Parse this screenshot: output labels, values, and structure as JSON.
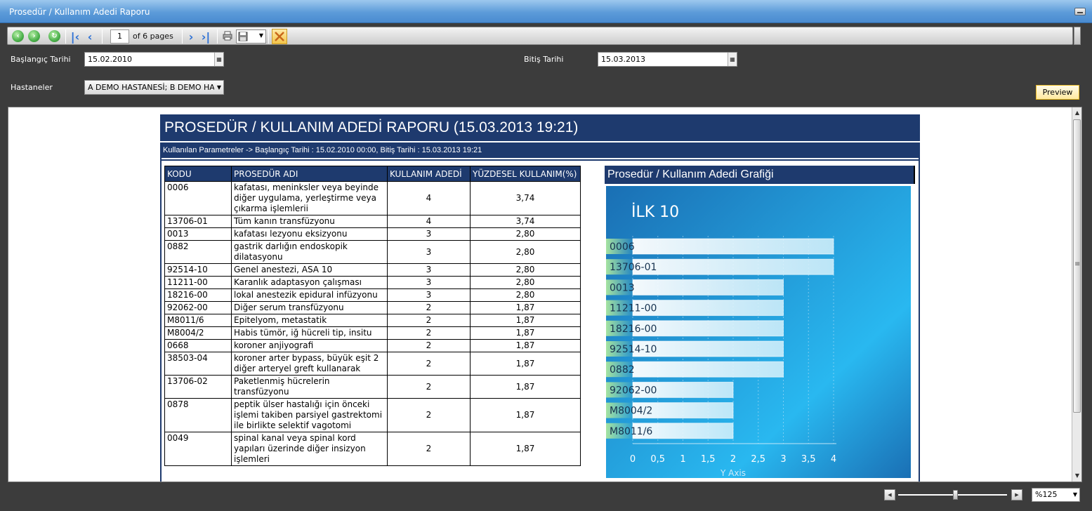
{
  "window": {
    "title": "Prosedür / Kullanım Adedi Raporu"
  },
  "toolbar": {
    "page_value": "1",
    "page_of_label": "of 6 pages"
  },
  "params": {
    "start_label": "Başlangıç Tarihi",
    "start_value": "15.02.2010",
    "end_label": "Bitiş Tarihi",
    "end_value": "15.03.2013",
    "hospitals_label": "Hastaneler",
    "hospitals_value": "A DEMO HASTANESİ; B DEMO HASTANESİ",
    "preview_label": "Preview"
  },
  "report": {
    "title": "PROSEDÜR / KULLANIM ADEDİ RAPORU (15.03.2013 19:21)",
    "params_line": "Kullanılan Parametreler -> Başlangıç Tarihi : 15.02.2010 00:00, Bitiş Tarihi : 15.03.2013 19:21",
    "columns": [
      "KODU",
      "PROSEDÜR ADI",
      "KULLANIM ADEDİ",
      "YÜZDESEL KULLANIM(%)"
    ],
    "rows": [
      {
        "code": "0006",
        "name": "kafatası, meninksler veya beyinde diğer uygulama, yerleştirme veya çıkarma işlemlerii",
        "count": "4",
        "pct": "3,74"
      },
      {
        "code": "13706-01",
        "name": "Tüm kanın transfüzyonu",
        "count": "4",
        "pct": "3,74"
      },
      {
        "code": "0013",
        "name": " kafatası lezyonu eksizyonu",
        "count": "3",
        "pct": "2,80"
      },
      {
        "code": "0882",
        "name": "gastrik darlığın endoskopik dilatasyonu",
        "count": "3",
        "pct": "2,80"
      },
      {
        "code": "92514-10",
        "name": "Genel anestezi, ASA 10",
        "count": "3",
        "pct": "2,80"
      },
      {
        "code": "11211-00",
        "name": "Karanlık adaptasyon çalışması",
        "count": "3",
        "pct": "2,80"
      },
      {
        "code": "18216-00",
        "name": "lokal anestezik epidural infüzyonu",
        "count": "3",
        "pct": "2,80"
      },
      {
        "code": "92062-00",
        "name": "Diğer serum transfüzyonu",
        "count": "2",
        "pct": "1,87"
      },
      {
        "code": "M8011/6",
        "name": "Epitelyom, metastatik",
        "count": "2",
        "pct": "1,87"
      },
      {
        "code": "M8004/2",
        "name": "Habis tümör, iğ hücreli tip, insitu",
        "count": "2",
        "pct": "1,87"
      },
      {
        "code": "0668",
        "name": "koroner anjiyografi",
        "count": "2",
        "pct": "1,87"
      },
      {
        "code": "38503-04",
        "name": "koroner arter bypass, büyük eşit 2 diğer arteryel greft kullanarak",
        "count": "2",
        "pct": "1,87"
      },
      {
        "code": "13706-02",
        "name": "Paketlenmiş hücrelerin transfüzyonu",
        "count": "2",
        "pct": "1,87"
      },
      {
        "code": "0878",
        "name": "peptik ülser hastalığı için önceki işlemi takiben parsiyel gastrektomi ile birlikte selektif vagotomi",
        "count": "2",
        "pct": "1,87"
      },
      {
        "code": "0049",
        "name": "spinal kanal veya spinal kord yapıları üzerinde diğer insizyon işlemleri",
        "count": "2",
        "pct": "1,87"
      }
    ],
    "chart_header": "Prosedür / Kullanım Adedi Grafiği"
  },
  "chart_data": {
    "type": "bar",
    "orientation": "horizontal",
    "title": "İLK 10",
    "categories": [
      "0006",
      "13706-01",
      "0013",
      "11211-00",
      "18216-00",
      "92514-10",
      "0882",
      "92062-00",
      "M8004/2",
      "M8011/6"
    ],
    "values": [
      4,
      4,
      3,
      3,
      3,
      3,
      3,
      2,
      2,
      2
    ],
    "xlim": [
      0,
      4
    ],
    "xticks": [
      "0",
      "0,5",
      "1",
      "1,5",
      "2",
      "2,5",
      "3",
      "3,5",
      "4"
    ],
    "xlabel": "Y Axis",
    "grid": true,
    "colors": {
      "bg_dark": "#1a6fb4",
      "bg_light": "#29b8f0",
      "bar": "#d6f1fb",
      "label_bg": "#a6e3a0"
    }
  },
  "bottom": {
    "zoom_value": "%125"
  }
}
